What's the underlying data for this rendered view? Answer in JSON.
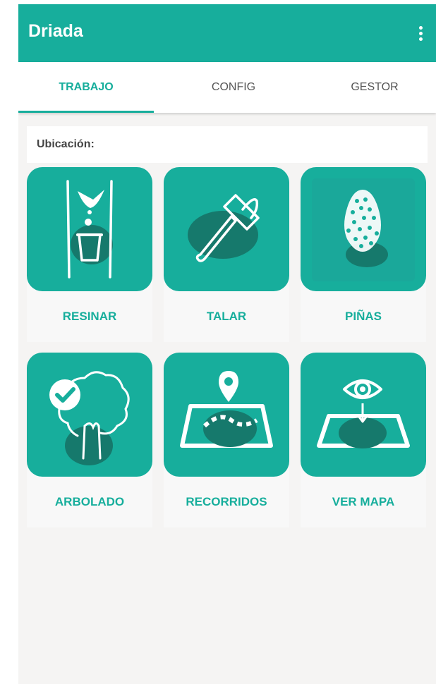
{
  "app": {
    "title": "Driada"
  },
  "tabs": [
    {
      "label": "TRABAJO",
      "active": true
    },
    {
      "label": "CONFIG",
      "active": false
    },
    {
      "label": "GESTOR",
      "active": false
    }
  ],
  "location": {
    "label": "Ubicación:"
  },
  "actions": [
    {
      "label": "RESINAR",
      "icon": "resin-icon"
    },
    {
      "label": "TALAR",
      "icon": "axe-icon"
    },
    {
      "label": "PIÑAS",
      "icon": "pinecone-icon"
    },
    {
      "label": "ARBOLADO",
      "icon": "tree-check-icon"
    },
    {
      "label": "RECORRIDOS",
      "icon": "route-map-icon"
    },
    {
      "label": "VER MAPA",
      "icon": "view-map-icon"
    }
  ],
  "colors": {
    "primary": "#17ae9c",
    "primary_dark": "#16796c",
    "background": "#f5f4f3",
    "white": "#ffffff"
  }
}
